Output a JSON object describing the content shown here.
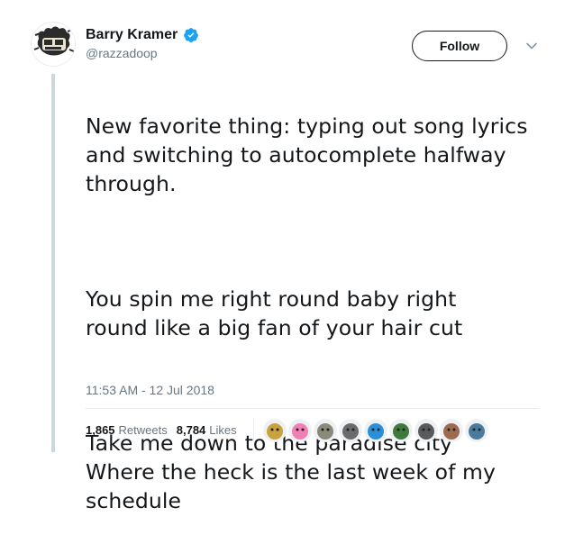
{
  "author": {
    "name": "Barry Kramer",
    "handle": "@razzadoop",
    "verified": true
  },
  "follow_button": {
    "label": "Follow"
  },
  "tweet": {
    "paragraphs": [
      "New favorite thing: typing out song lyrics\nand switching to autocomplete halfway\nthrough.",
      "You spin me right round baby right\nround like a big fan of your hair cut",
      "Take me down to the paradise city\nWhere the heck is the last week of my\nschedule"
    ],
    "timestamp": "11:53 AM - 12 Jul 2018"
  },
  "stats": {
    "retweets_count": "1,865",
    "retweets_label": "Retweets",
    "likes_count": "8,784",
    "likes_label": "Likes"
  },
  "likers": [
    {
      "name": "liker-1",
      "color": "#c8a23a"
    },
    {
      "name": "liker-2",
      "color": "#f27fb4"
    },
    {
      "name": "liker-3",
      "color": "#8a8a7a"
    },
    {
      "name": "liker-4",
      "color": "#6b6b6b"
    },
    {
      "name": "liker-5",
      "color": "#2a8fd6"
    },
    {
      "name": "liker-6",
      "color": "#3e7b3a"
    },
    {
      "name": "liker-7",
      "color": "#5a5a5a"
    },
    {
      "name": "liker-8",
      "color": "#9c6b4e"
    },
    {
      "name": "liker-9",
      "color": "#4a7a9c"
    }
  ],
  "colors": {
    "verified_blue": "#1da1f2",
    "muted_text": "#657786",
    "primary_text": "#14171a"
  }
}
